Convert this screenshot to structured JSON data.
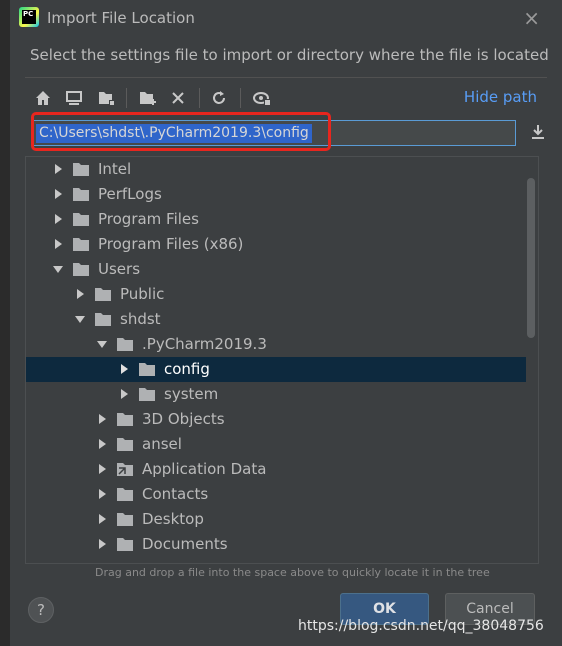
{
  "window": {
    "app_icon_text": "PC",
    "title": "Import File Location",
    "close_glyph": "×"
  },
  "subtitle": "Select the settings file to import or directory where the file is located",
  "toolbar": {
    "buttons": [
      "home-icon",
      "desktop-icon",
      "project-icon",
      "new-folder-icon",
      "delete-icon",
      "refresh-icon",
      "show-hidden-icon"
    ],
    "hide_path_label": "Hide path"
  },
  "path": {
    "value": "C:\\Users\\shdst\\.PyCharm2019.3\\config"
  },
  "tree": {
    "items": [
      {
        "label": "Intel",
        "depth": 0,
        "expanded": false
      },
      {
        "label": "PerfLogs",
        "depth": 0,
        "expanded": false
      },
      {
        "label": "Program Files",
        "depth": 0,
        "expanded": false
      },
      {
        "label": "Program Files (x86)",
        "depth": 0,
        "expanded": false
      },
      {
        "label": "Users",
        "depth": 0,
        "expanded": true
      },
      {
        "label": "Public",
        "depth": 1,
        "expanded": false
      },
      {
        "label": "shdst",
        "depth": 1,
        "expanded": true
      },
      {
        "label": ".PyCharm2019.3",
        "depth": 2,
        "expanded": true
      },
      {
        "label": "config",
        "depth": 3,
        "expanded": false,
        "selected": true
      },
      {
        "label": "system",
        "depth": 3,
        "expanded": false
      },
      {
        "label": "3D Objects",
        "depth": 2,
        "expanded": false
      },
      {
        "label": "ansel",
        "depth": 2,
        "expanded": false
      },
      {
        "label": "Application Data",
        "depth": 2,
        "expanded": false,
        "link": true
      },
      {
        "label": "Contacts",
        "depth": 2,
        "expanded": false
      },
      {
        "label": "Desktop",
        "depth": 2,
        "expanded": false
      },
      {
        "label": "Documents",
        "depth": 2,
        "expanded": false
      }
    ]
  },
  "hint": "Drag and drop a file into the space above to quickly locate it in the tree",
  "buttons": {
    "help": "?",
    "ok": "OK",
    "cancel": "Cancel"
  },
  "watermark": "https://blog.csdn.net/qq_38048756",
  "colors": {
    "background": "#3c3f41",
    "accent_link": "#589df6",
    "selection": "#0d293e",
    "highlight_box": "#e8261e",
    "ok_button": "#365880"
  }
}
